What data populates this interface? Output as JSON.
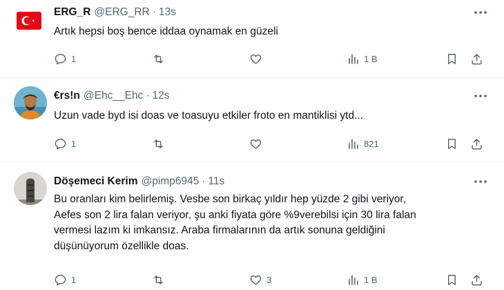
{
  "tweets": [
    {
      "name": "ERG_R",
      "handle": "@ERG_RR",
      "dot": "·",
      "time": "13s",
      "avatar": "turkey-flag",
      "text": "Artık hepsi boş bence iddaa oynamak en güzeli",
      "replies": "1",
      "retweets": "",
      "likes": "",
      "views": "1 B"
    },
    {
      "name": "€rs!n",
      "handle": "@Ehc__Ehc",
      "dot": "·",
      "time": "12s",
      "avatar": "profile-photo",
      "text": "Uzun vade byd isi doas ve toasuyu etkiler froto en mantiklisi ytd...",
      "replies": "1",
      "retweets": "",
      "likes": "",
      "views": "821"
    },
    {
      "name": "Döşemeci Kerim",
      "handle": "@pimp6945",
      "dot": "·",
      "time": "11s",
      "avatar": "tower-photo",
      "text": "Bu oranları kim belirlemiş. Vesbe son birkaç yıldır hep yüzde 2 gibi veriyor,\nAefes son 2 lira falan veriyor, şu anki fiyata göre %9verebilsi için 30 lira falan\nvermesi lazım ki imkansız. Araba firmalarının da artık sonuna geldiğini\ndüşünüyorum özellikle doas.",
      "replies": "1",
      "retweets": "",
      "likes": "3",
      "views": "1 B"
    }
  ],
  "colors": {
    "text": "#0f1419",
    "muted": "#536471",
    "divider": "#eff3f4",
    "flag_red": "#e30a17"
  }
}
